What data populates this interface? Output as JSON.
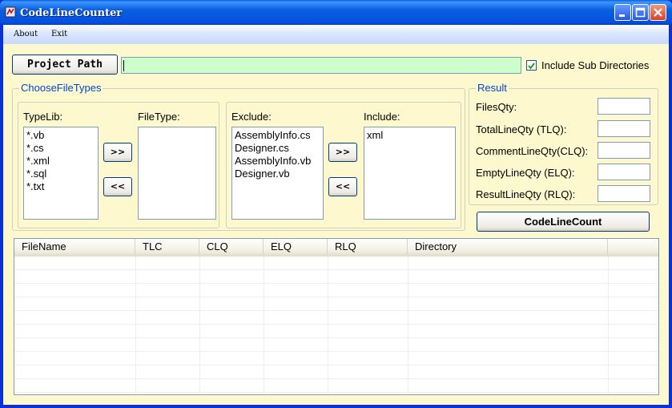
{
  "window": {
    "title": "CodeLineCounter",
    "controls": {
      "minimize_icon": "minimize-icon",
      "maximize_icon": "maximize-icon",
      "close_icon": "close-icon"
    }
  },
  "menu": {
    "items": [
      "About",
      "Exit"
    ]
  },
  "toolbar": {
    "project_path_label": "Project Path",
    "project_path_value": "",
    "include_subdirs_label": "Include Sub Directories",
    "include_subdirs_checked": true
  },
  "file_types": {
    "group_title": "ChooseFileTypes",
    "typelib_label": "TypeLib:",
    "typelib_items": [
      "*.vb",
      "*.cs",
      "*.xml",
      "*.sql",
      "*.txt"
    ],
    "filetype_label": "FileType:",
    "filetype_items": [],
    "add_label": ">>",
    "remove_label": "<<",
    "exclude_label": "Exclude:",
    "exclude_items": [
      "AssemblyInfo.cs",
      "Designer.cs",
      "AssemblyInfo.vb",
      "Designer.vb"
    ],
    "include_label": "Include:",
    "include_items": [
      "xml"
    ]
  },
  "result": {
    "group_title": "Result",
    "fields": [
      {
        "label": "FilesQty:",
        "value": ""
      },
      {
        "label": "TotalLineQty (TLQ):",
        "value": ""
      },
      {
        "label": "CommentLineQty(CLQ):",
        "value": ""
      },
      {
        "label": "EmptyLineQty (ELQ):",
        "value": ""
      },
      {
        "label": "ResultLineQty (RLQ):",
        "value": ""
      }
    ],
    "count_button_label": "CodeLineCount"
  },
  "grid": {
    "columns": [
      "FileName",
      "TLC",
      "CLQ",
      "ELQ",
      "RLQ",
      "Directory"
    ],
    "rows": []
  },
  "colors": {
    "window_bg": "#fdf8cd",
    "path_field_bg": "#ccffcc",
    "group_title": "#0046d5",
    "titlebar": "#0a5fde"
  }
}
